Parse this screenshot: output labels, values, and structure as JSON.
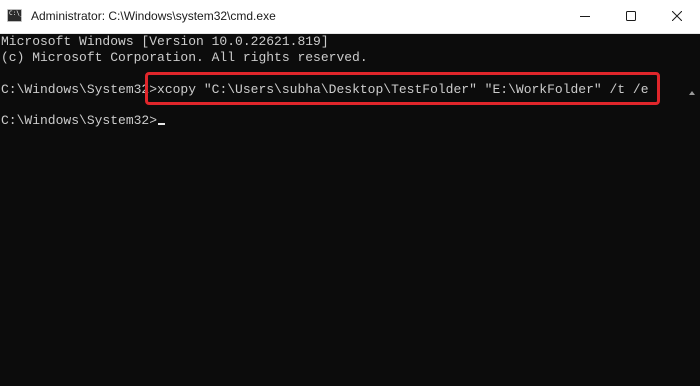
{
  "window": {
    "title": "Administrator: C:\\Windows\\system32\\cmd.exe",
    "icon": "cmd-icon",
    "controls": {
      "minimize": "minimize-icon",
      "maximize": "maximize-icon",
      "close": "close-icon"
    }
  },
  "terminal": {
    "lines": [
      "Microsoft Windows [Version 10.0.22621.819]",
      "(c) Microsoft Corporation. All rights reserved."
    ],
    "prompt": "C:\\Windows\\System32>",
    "command": "xcopy \"C:\\Users\\subha\\Desktop\\TestFolder\" \"E:\\WorkFolder\" /t /e",
    "final_prompt": "C:\\Windows\\System32>"
  },
  "colors": {
    "terminal_bg": "#0c0c0c",
    "terminal_text": "#cccccc",
    "highlight_border": "#e0262b",
    "titlebar_bg": "#ffffff"
  }
}
